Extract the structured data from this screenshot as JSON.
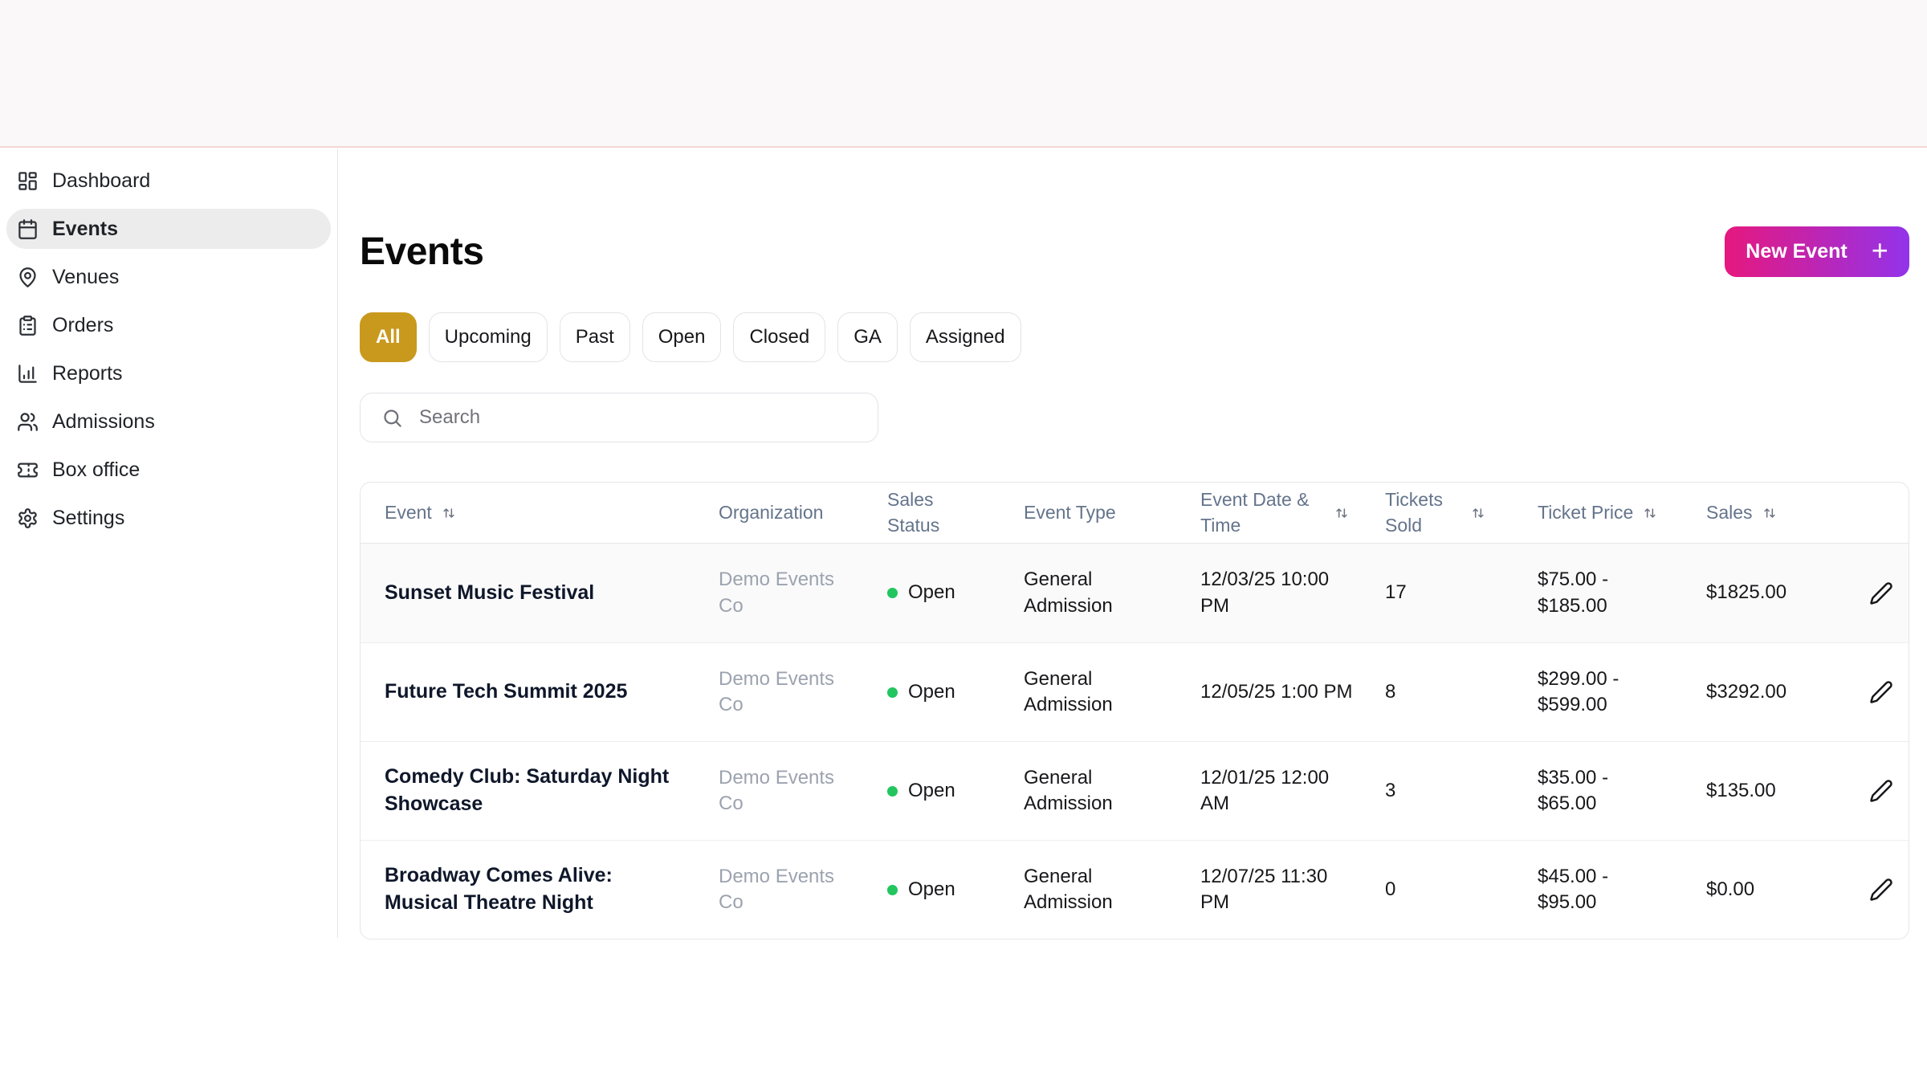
{
  "header": {
    "title": "Events",
    "new_event": {
      "label": "New Event",
      "plus": "+"
    }
  },
  "sidebar": {
    "items": [
      {
        "label": "Dashboard",
        "icon": "dashboard-icon",
        "active": false
      },
      {
        "label": "Events",
        "icon": "calendar-icon",
        "active": true
      },
      {
        "label": "Venues",
        "icon": "map-pin-icon",
        "active": false
      },
      {
        "label": "Orders",
        "icon": "clipboard-icon",
        "active": false
      },
      {
        "label": "Reports",
        "icon": "bar-chart-icon",
        "active": false
      },
      {
        "label": "Admissions",
        "icon": "users-icon",
        "active": false
      },
      {
        "label": "Box office",
        "icon": "ticket-icon",
        "active": false
      },
      {
        "label": "Settings",
        "icon": "gear-icon",
        "active": false
      }
    ]
  },
  "filters": {
    "items": [
      {
        "label": "All",
        "active": true
      },
      {
        "label": "Upcoming",
        "active": false
      },
      {
        "label": "Past",
        "active": false
      },
      {
        "label": "Open",
        "active": false
      },
      {
        "label": "Closed",
        "active": false
      },
      {
        "label": "GA",
        "active": false
      },
      {
        "label": "Assigned",
        "active": false
      }
    ]
  },
  "search": {
    "placeholder": "Search",
    "icon": "search-icon"
  },
  "table": {
    "columns": [
      {
        "label": "Event",
        "sortable": true
      },
      {
        "label": "Organization",
        "sortable": false
      },
      {
        "label": "Sales Status",
        "sortable": false
      },
      {
        "label": "Event Type",
        "sortable": false
      },
      {
        "label": "Event Date & Time",
        "sortable": true
      },
      {
        "label": "Tickets Sold",
        "sortable": true
      },
      {
        "label": "Ticket Price",
        "sortable": true
      },
      {
        "label": "Sales",
        "sortable": true
      }
    ],
    "rows": [
      {
        "event": "Sunset Music Festival",
        "organization": "Demo Events Co",
        "sales_status": "Open",
        "event_type": "General Admission",
        "event_datetime": "12/03/25 10:00 PM",
        "tickets_sold": "17",
        "ticket_price": "$75.00 - $185.00",
        "sales": "$1825.00"
      },
      {
        "event": "Future Tech Summit 2025",
        "organization": "Demo Events Co",
        "sales_status": "Open",
        "event_type": "General Admission",
        "event_datetime": "12/05/25 1:00 PM",
        "tickets_sold": "8",
        "ticket_price": "$299.00 - $599.00",
        "sales": "$3292.00"
      },
      {
        "event": "Comedy Club: Saturday Night Showcase",
        "organization": "Demo Events Co",
        "sales_status": "Open",
        "event_type": "General Admission",
        "event_datetime": "12/01/25 12:00 AM",
        "tickets_sold": "3",
        "ticket_price": "$35.00 - $65.00",
        "sales": "$135.00"
      },
      {
        "event": "Broadway Comes Alive: Musical Theatre Night",
        "organization": "Demo Events Co",
        "sales_status": "Open",
        "event_type": "General Admission",
        "event_datetime": "12/07/25 11:30 PM",
        "tickets_sold": "0",
        "ticket_price": "$45.00 - $95.00",
        "sales": "$0.00"
      }
    ]
  },
  "colors": {
    "filter_active_bg": "#c9991e",
    "new_event_gradient_from": "#e6187e",
    "new_event_gradient_to": "#9333ea",
    "status_open_dot": "#22c55e",
    "top_divider": "#f2d7d5"
  }
}
